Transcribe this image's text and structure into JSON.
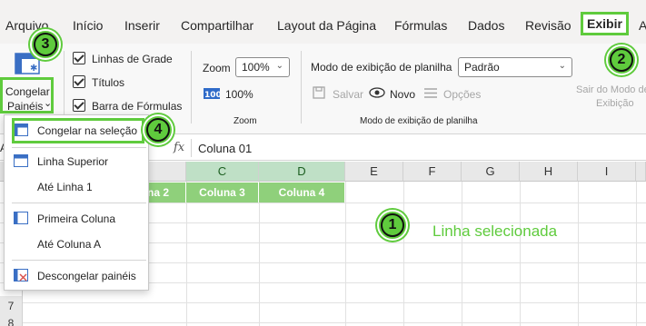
{
  "menu": {
    "items": [
      "Arquivo",
      "Início",
      "Inserir",
      "Compartilhar",
      "Layout da Página",
      "Fórmulas",
      "Dados",
      "Revisão",
      "Exibir",
      "A"
    ],
    "active": "Exibir"
  },
  "ribbon": {
    "freeze_button": {
      "line1": "Congelar",
      "line2": "Painéis",
      "chevron": "⌄"
    },
    "checkboxes": [
      {
        "label": "Linhas de Grade",
        "checked": true
      },
      {
        "label": "Títulos",
        "checked": true
      },
      {
        "label": "Barra de Fórmulas",
        "checked": true
      }
    ],
    "zoom": {
      "label": "Zoom",
      "value": "100%",
      "button_label": "100%",
      "group_label": "Zoom"
    },
    "sheet_view": {
      "label": "Modo de exibição de planilha",
      "value": "Padrão",
      "save": "Salvar",
      "new": "Novo",
      "options": "Opções",
      "group_label": "Modo de exibição de planilha",
      "exit_line1": "Sair do Modo de",
      "exit_line2": "Exibição"
    }
  },
  "formula_bar": {
    "fx": "fx",
    "value": "Coluna 01",
    "namebox_fragment": "A"
  },
  "dropdown": {
    "items": [
      {
        "label": "Congelar na seleção",
        "icon": "freeze-panes-icon"
      },
      {
        "label": "Linha Superior",
        "icon": "freeze-top-row-icon"
      },
      {
        "label": "Até Linha 1",
        "icon": ""
      },
      {
        "label": "Primeira Coluna",
        "icon": "freeze-first-column-icon"
      },
      {
        "label": "Até Coluna A",
        "icon": ""
      },
      {
        "label": "Descongelar painéis",
        "icon": "unfreeze-panes-icon"
      }
    ]
  },
  "grid": {
    "columns": [
      "C",
      "D",
      "E",
      "F",
      "G",
      "H",
      "I"
    ],
    "selected_columns": [
      "C",
      "D"
    ],
    "row1_cells": [
      "na 2",
      "Coluna 3",
      "Coluna 4"
    ],
    "row_numbers": [
      "7",
      "8"
    ]
  },
  "annotations": {
    "badges": [
      "1",
      "2",
      "3",
      "4"
    ],
    "callout_text": "Linha selecionada"
  },
  "colors": {
    "highlight": "#5fcb3d",
    "selected_header": "#bfe0c6",
    "selected_cell": "#8fd07b"
  }
}
